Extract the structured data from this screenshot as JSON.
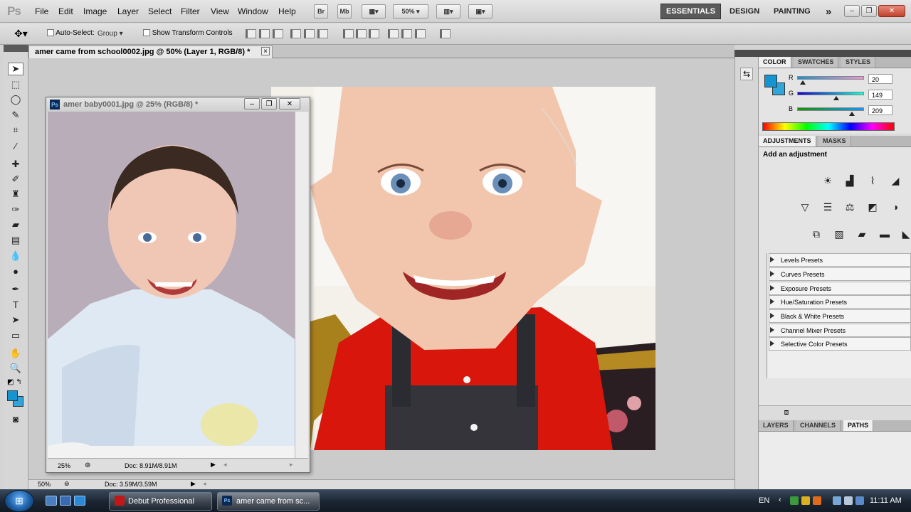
{
  "app": {
    "logo": "Ps"
  },
  "menu": [
    "File",
    "Edit",
    "Image",
    "Layer",
    "Select",
    "Filter",
    "View",
    "Window",
    "Help"
  ],
  "appbar": {
    "bridge_label": "Br",
    "minibridge_label": "Mb",
    "zoom": "50%"
  },
  "workspaces": {
    "essentials": "ESSENTIALS",
    "design": "DESIGN",
    "painting": "PAINTING",
    "more": "»"
  },
  "options": {
    "auto_select_label": "Auto-Select:",
    "auto_select_value": "Group",
    "transform_label": "Show Transform Controls"
  },
  "doc_tab": {
    "title": "amer came from school0002.jpg @ 50% (Layer 1, RGB/8) *",
    "close": "×"
  },
  "float_doc": {
    "title": "amer baby0001.jpg @ 25% (RGB/8) *",
    "zoom": "25%",
    "doc_info": "Doc: 8.91M/8.91M"
  },
  "status": {
    "zoom": "50%",
    "doc_info": "Doc: 3.59M/3.59M"
  },
  "color_panel": {
    "tabs": [
      "COLOR",
      "SWATCHES",
      "STYLES"
    ],
    "fg_color": "#1495d1",
    "bg_color": "#30a5da",
    "r_label": "R",
    "g_label": "G",
    "b_label": "B",
    "r": "20",
    "g": "149",
    "b": "209"
  },
  "adjustments": {
    "tabs": [
      "ADJUSTMENTS",
      "MASKS"
    ],
    "title": "Add an adjustment",
    "presets": [
      "Levels Presets",
      "Curves Presets",
      "Exposure Presets",
      "Hue/Saturation Presets",
      "Black & White Presets",
      "Channel Mixer Presets",
      "Selective Color Presets"
    ]
  },
  "layers_panel": {
    "tabs": [
      "LAYERS",
      "CHANNELS",
      "PATHS"
    ]
  },
  "taskbar": {
    "tasks": [
      "Debut Professional",
      "amer came from sc..."
    ],
    "lang": "EN",
    "clock": "11:11 AM"
  }
}
